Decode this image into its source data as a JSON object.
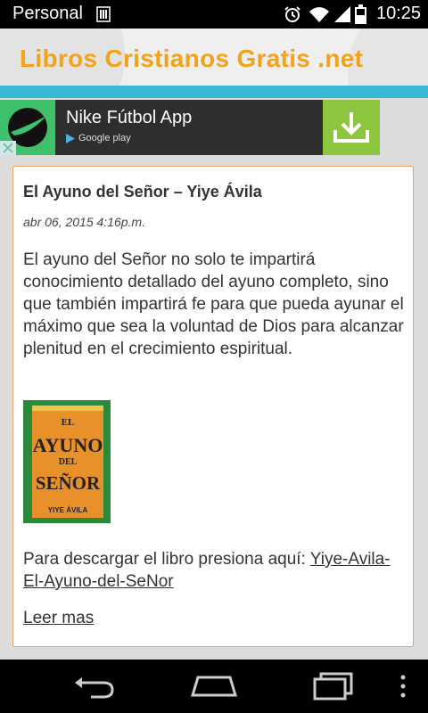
{
  "status_bar": {
    "carrier": "Personal",
    "time": "10:25",
    "icons": [
      "sim-icon",
      "alarm-icon",
      "wifi-icon",
      "signal-icon",
      "battery-icon"
    ]
  },
  "header": {
    "site_title": "Libros Cristianos Gratis .net",
    "title_color": "#f2a21b",
    "strip_color": "#38b8d6"
  },
  "ad": {
    "title": "Nike Fútbol App",
    "store_label": "Google play",
    "icons": [
      "nike-logo-icon",
      "play-store-icon",
      "download-icon",
      "close-icon"
    ],
    "download_bg": "#8cc63e"
  },
  "post": {
    "title": "El Ayuno del Señor – Yiye Ávila",
    "date": "abr 06, 2015 4:16p.m.",
    "body": "El ayuno del Señor no solo te impartirá conocimiento detallado del ayuno completo, sino que también impartirá fe para que pueda ayunar el máximo que sea la voluntad de Dios para alcanzar plenitud en el crecimiento espiritual.",
    "book_cover": {
      "line1": "EL",
      "line2": "AYUNO",
      "line3": "DEL",
      "line4": "SEÑOR",
      "author": "YIYE ÁVILA"
    },
    "download_prefix": "Para descargar el libro presiona aquí:",
    "download_link": "Yiye-Avila-El-Ayuno-del-SeNor",
    "read_more": "Leer mas",
    "border_color": "#f0a060"
  },
  "nav_bar": {
    "icons": [
      "back-icon",
      "home-icon",
      "recent-apps-icon",
      "menu-icon"
    ]
  }
}
